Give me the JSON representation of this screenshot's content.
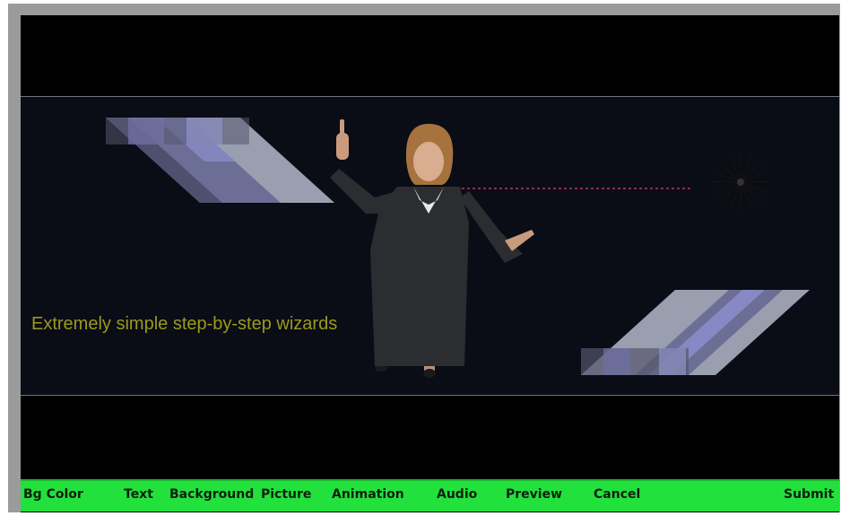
{
  "banner": {
    "caption": "Extremely simple step-by-step wizards"
  },
  "toolbar": {
    "items": [
      {
        "label": "Bg Color"
      },
      {
        "label": "Text"
      },
      {
        "label": "Background"
      },
      {
        "label": "Picture"
      },
      {
        "label": "Animation"
      },
      {
        "label": "Audio"
      },
      {
        "label": "Preview"
      },
      {
        "label": "Cancel"
      },
      {
        "label": "Submit"
      }
    ]
  },
  "colors": {
    "toolbar_bg": "#22e13d",
    "stage_bg": "#0a0c16",
    "caption": "#9c9a1d",
    "frame": "#9b9b9b"
  },
  "icons": {
    "burst": "starburst-icon"
  }
}
